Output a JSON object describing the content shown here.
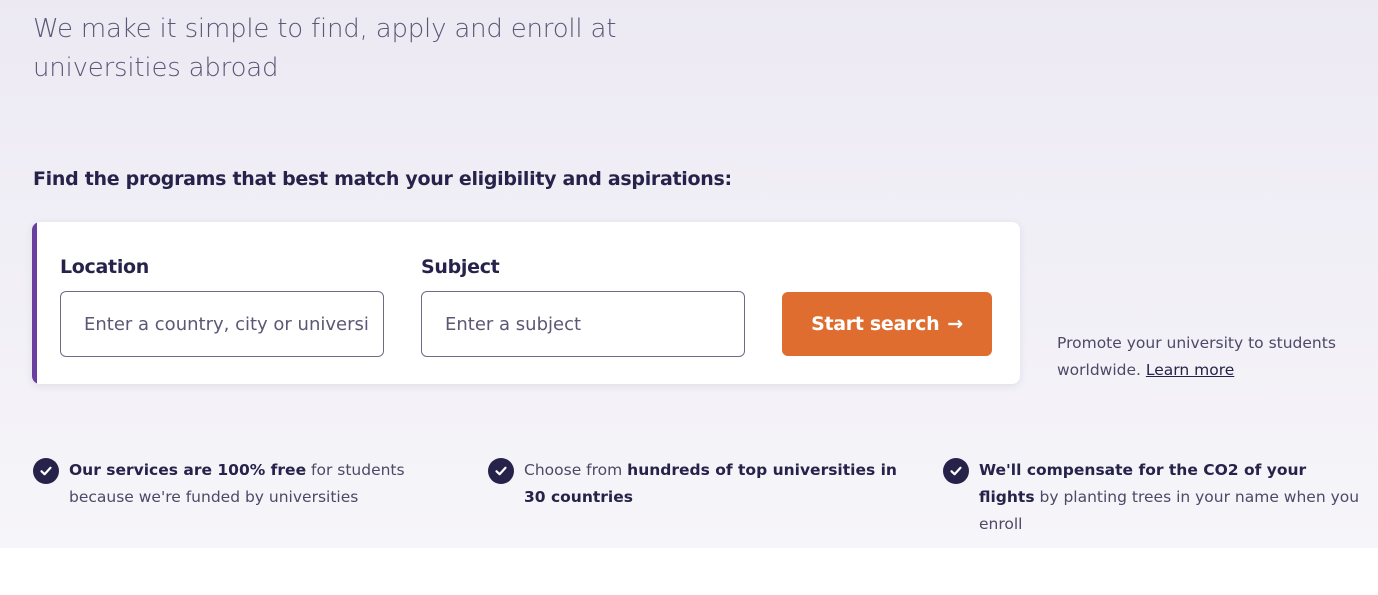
{
  "hero": {
    "tagline": "We make it simple to find, apply and enroll at universities abroad",
    "find_heading": "Find the programs that best match your eligibility and aspirations:"
  },
  "search": {
    "location_label": "Location",
    "location_placeholder": "Enter a country, city or university",
    "subject_label": "Subject",
    "subject_placeholder": "Enter a subject",
    "button_label": "Start search",
    "button_arrow": "→"
  },
  "promote": {
    "text": "Promote your university to students worldwide. ",
    "link": "Learn more"
  },
  "benefits": [
    {
      "icon": "check-circle-icon",
      "bold": "Our services are 100% free",
      "rest": " for students because we're funded by universities"
    },
    {
      "icon": "check-circle-icon",
      "lead": "Choose from ",
      "bold": "hundreds of top universities in 30 countries"
    },
    {
      "icon": "check-circle-icon",
      "bold": "We'll compensate for the CO2 of your flights",
      "rest": " by planting trees in your name when you enroll"
    }
  ],
  "colors": {
    "accent_purple": "#6a3fa0",
    "button_orange": "#df6d2f",
    "text_dark": "#26224a"
  }
}
